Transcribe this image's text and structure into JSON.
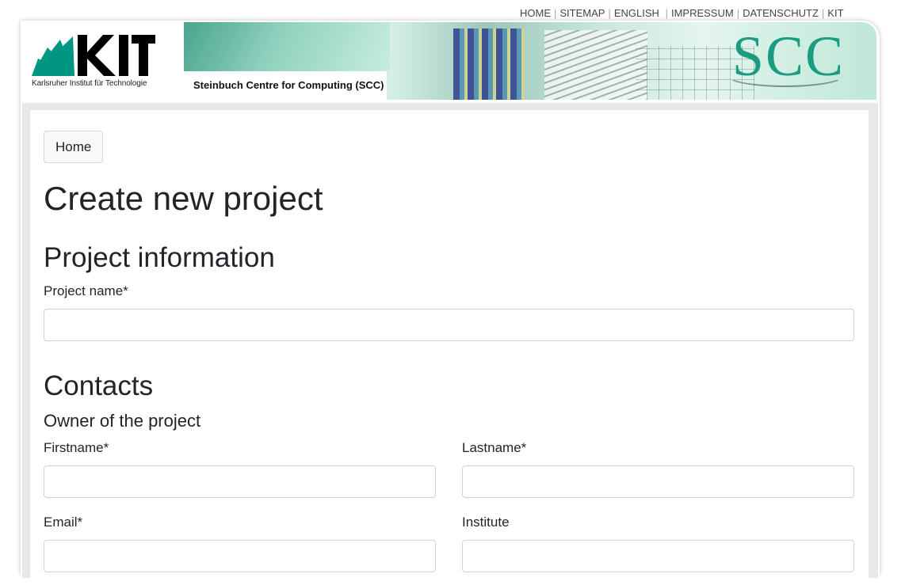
{
  "top_nav": {
    "links": [
      "HOME",
      "SITEMAP",
      "ENGLISH",
      "IMPRESSUM",
      "DATENSCHUTZ",
      "KIT"
    ]
  },
  "header": {
    "kit_logo_text": "KIT",
    "kit_tagline": "Karlsruher Institut für Technologie",
    "centre_name": "Steinbuch Centre for Computing (SCC)",
    "banner_logo": "SCC"
  },
  "breadcrumb": {
    "home_label": "Home"
  },
  "page": {
    "title": "Create new project",
    "project_section": {
      "heading": "Project information",
      "project_name_label": "Project name*",
      "project_name_value": ""
    },
    "contacts_section": {
      "heading": "Contacts",
      "owner_heading": "Owner of the project",
      "firstname_label": "Firstname*",
      "lastname_label": "Lastname*",
      "email_label": "Email*",
      "institute_label": "Institute"
    }
  },
  "colors": {
    "kit_green": "#009682",
    "scc_green": "#1a9c80",
    "frame_bg": "#e8e8e8"
  }
}
